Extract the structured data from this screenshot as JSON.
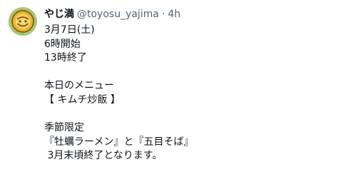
{
  "author": {
    "display_name": "やじ満",
    "handle": "@toyosu_yajima",
    "separator": "·",
    "timestamp": "4h"
  },
  "post": {
    "lines": [
      "3月7日(土)",
      "6時開始",
      "13時終了",
      "",
      "本日のメニュー",
      "【 キムチ炒飯 】",
      "",
      "季節限定",
      "『牡蠣ラーメン』と『五目そば』",
      " 3月末頃終了となります。"
    ]
  },
  "colors": {
    "text": "#0f1419",
    "secondary": "#536471",
    "avatar_bg": "#a7c76f"
  },
  "icons": {
    "avatar": "bowl-logo-avatar"
  }
}
